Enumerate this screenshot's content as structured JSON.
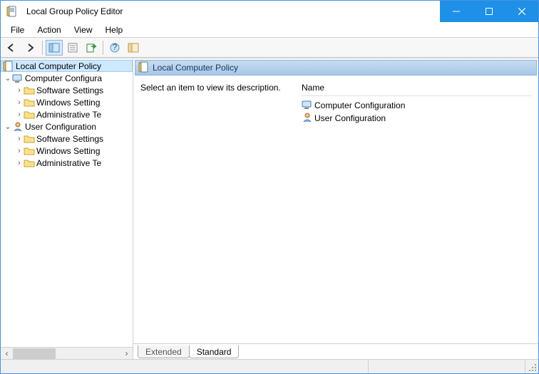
{
  "window": {
    "title": "Local Group Policy Editor"
  },
  "menu": {
    "file": "File",
    "action": "Action",
    "view": "View",
    "help": "Help"
  },
  "tree": {
    "root": "Local Computer Policy",
    "computer": {
      "label": "Computer Configura",
      "children": {
        "software": "Software Settings",
        "windows": "Windows Setting",
        "admin": "Administrative Te"
      }
    },
    "user": {
      "label": "User Configuration",
      "children": {
        "software": "Software Settings",
        "windows": "Windows Setting",
        "admin": "Administrative Te"
      }
    }
  },
  "detail": {
    "title": "Local Computer Policy",
    "hint": "Select an item to view its description.",
    "col_name": "Name",
    "items": {
      "computer": "Computer Configuration",
      "user": "User Configuration"
    }
  },
  "tabs": {
    "extended": "Extended",
    "standard": "Standard"
  }
}
